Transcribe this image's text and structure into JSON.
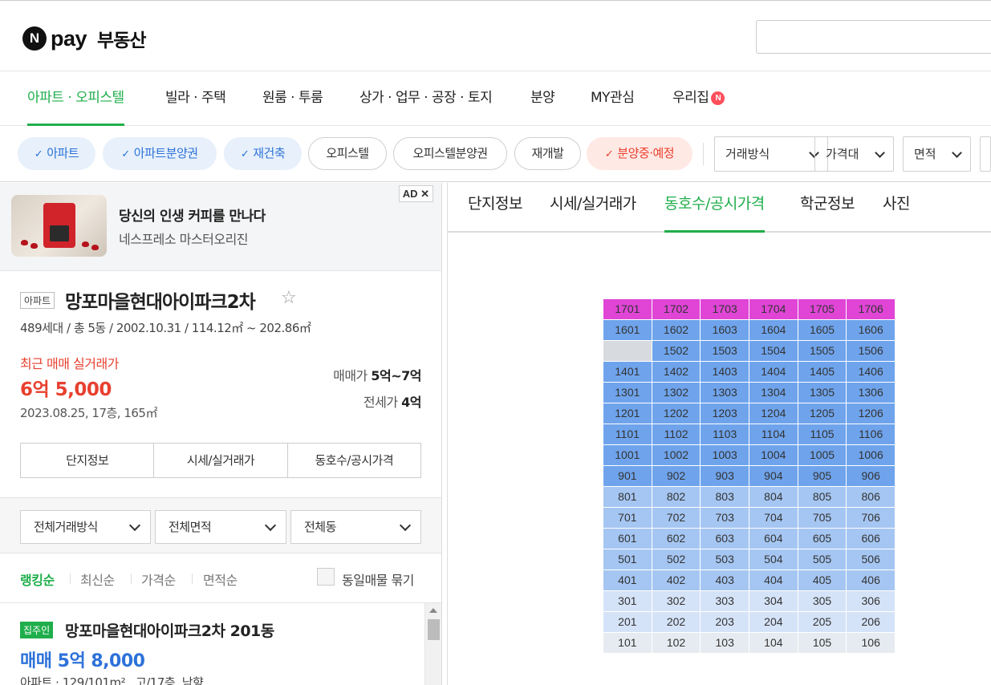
{
  "header": {
    "logo_n": "N",
    "logo_pay": "pay",
    "logo_name": "부동산"
  },
  "main_nav": [
    {
      "label": "아파트 · 오피스텔",
      "active": true
    },
    {
      "label": "빌라 · 주택",
      "active": false
    },
    {
      "label": "원룸 · 투룸",
      "active": false
    },
    {
      "label": "상가 · 업무 · 공장 · 토지",
      "active": false
    },
    {
      "label": "분양",
      "active": false
    },
    {
      "label": "MY관심",
      "active": false
    },
    {
      "label": "우리집",
      "badge": "N",
      "active": false
    }
  ],
  "filters": {
    "chips": [
      {
        "label": "아파트",
        "checked": true,
        "style": "blue"
      },
      {
        "label": "아파트분양권",
        "checked": true,
        "style": "blue"
      },
      {
        "label": "재건축",
        "checked": true,
        "style": "blue"
      },
      {
        "label": "오피스텔",
        "checked": false,
        "style": "plain"
      },
      {
        "label": "오피스텔분양권",
        "checked": false,
        "style": "plain"
      },
      {
        "label": "재개발",
        "checked": false,
        "style": "plain"
      },
      {
        "label": "분양중·예정",
        "checked": true,
        "style": "red"
      }
    ],
    "dropdowns": [
      "거래방식",
      "가격대",
      "면적"
    ]
  },
  "ad": {
    "badge": "AD",
    "close": "✕",
    "title": "당신의 인생 커피를 만나다",
    "subtitle": "네스프레소 마스터오리진"
  },
  "complex": {
    "type_tag": "아파트",
    "name": "망포마을현대아이파크2차",
    "favorite_icon": "☆",
    "info": "489세대 / 총 5동 / 2002.10.31 / 114.12㎡ ~ 202.86㎡",
    "recent_label": "최근 매매 실거래가",
    "recent_price": "6억 5,000",
    "recent_date": "2023.08.25, 17층, 165㎡",
    "sale_label": "매매가",
    "sale_range": "5억~7억",
    "jeonse_label": "전세가",
    "jeonse_range": "4억",
    "tabs": [
      "단지정보",
      "시세/실거래가",
      "동호수/공시가격"
    ]
  },
  "list_filters": [
    "전체거래방식",
    "전체면적",
    "전체동"
  ],
  "sort": {
    "options": [
      {
        "label": "랭킹순",
        "active": true
      },
      {
        "label": "최신순",
        "active": false
      },
      {
        "label": "가격순",
        "active": false
      },
      {
        "label": "면적순",
        "active": false
      }
    ],
    "same_listing_label": "동일매물 묶기"
  },
  "listing": {
    "tag": "집주인",
    "name": "망포마을현대아이파크2차 201동",
    "price": "매매 5억 8,000",
    "spec": "아파트 · 129/101m² , 고/17층, 남향"
  },
  "detail_tabs": [
    {
      "label": "단지정보",
      "active": false
    },
    {
      "label": "시세/실거래가",
      "active": false
    },
    {
      "label": "동호수/공시가격",
      "active": true
    },
    {
      "label": "학군정보",
      "active": false
    },
    {
      "label": "사진",
      "active": false
    }
  ],
  "unit_grid": {
    "colors": {
      "top": "#e045d6",
      "dark": "#6fa4ec",
      "mid": "#a5c6f2",
      "light": "#d5e3f8",
      "pale": "#e6ebf1",
      "empty": "#d7dbe0"
    },
    "rows": [
      {
        "shade": "top",
        "units": [
          "1701",
          "1702",
          "1703",
          "1704",
          "1705",
          "1706"
        ]
      },
      {
        "shade": "dark",
        "units": [
          "1601",
          "1602",
          "1603",
          "1604",
          "1605",
          "1606"
        ]
      },
      {
        "shade": "dark",
        "units": [
          "",
          "1502",
          "1503",
          "1504",
          "1505",
          "1506"
        ]
      },
      {
        "shade": "dark",
        "units": [
          "1401",
          "1402",
          "1403",
          "1404",
          "1405",
          "1406"
        ]
      },
      {
        "shade": "dark",
        "units": [
          "1301",
          "1302",
          "1303",
          "1304",
          "1305",
          "1306"
        ]
      },
      {
        "shade": "dark",
        "units": [
          "1201",
          "1202",
          "1203",
          "1204",
          "1205",
          "1206"
        ]
      },
      {
        "shade": "dark",
        "units": [
          "1101",
          "1102",
          "1103",
          "1104",
          "1105",
          "1106"
        ]
      },
      {
        "shade": "dark",
        "units": [
          "1001",
          "1002",
          "1003",
          "1004",
          "1005",
          "1006"
        ]
      },
      {
        "shade": "dark",
        "units": [
          "901",
          "902",
          "903",
          "904",
          "905",
          "906"
        ]
      },
      {
        "shade": "mid",
        "units": [
          "801",
          "802",
          "803",
          "804",
          "805",
          "806"
        ]
      },
      {
        "shade": "mid",
        "units": [
          "701",
          "702",
          "703",
          "704",
          "705",
          "706"
        ]
      },
      {
        "shade": "mid",
        "units": [
          "601",
          "602",
          "603",
          "604",
          "605",
          "606"
        ]
      },
      {
        "shade": "mid",
        "units": [
          "501",
          "502",
          "503",
          "504",
          "505",
          "506"
        ]
      },
      {
        "shade": "mid",
        "units": [
          "401",
          "402",
          "403",
          "404",
          "405",
          "406"
        ]
      },
      {
        "shade": "light",
        "units": [
          "301",
          "302",
          "303",
          "304",
          "305",
          "306"
        ]
      },
      {
        "shade": "light",
        "units": [
          "201",
          "202",
          "203",
          "204",
          "205",
          "206"
        ]
      },
      {
        "shade": "pale",
        "units": [
          "101",
          "102",
          "103",
          "104",
          "105",
          "106"
        ]
      }
    ]
  },
  "colors": {
    "accent_green": "#1fae4b",
    "accent_red": "#e8402f",
    "accent_blue": "#2d72d9"
  }
}
